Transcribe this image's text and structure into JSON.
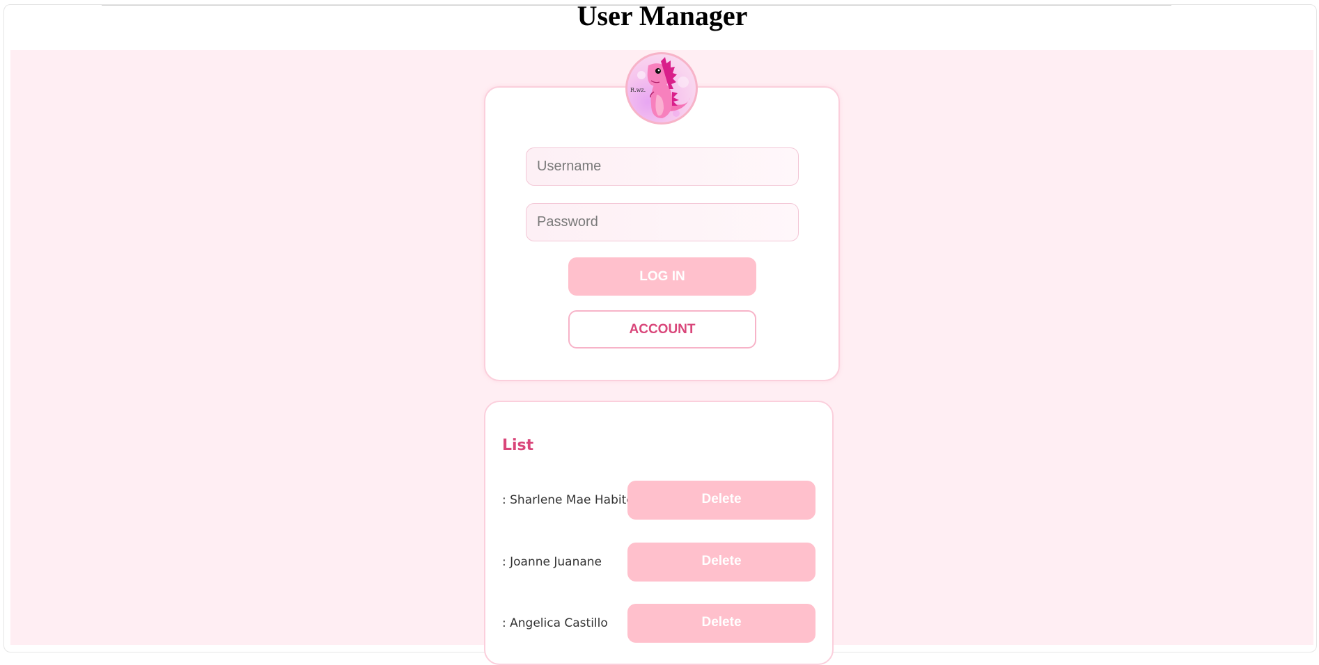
{
  "app": {
    "title": "User Manager"
  },
  "login": {
    "avatar_icon": "pink-dinosaur-avatar",
    "avatar_text": "R.wz.",
    "username_placeholder": "Username",
    "password_placeholder": "Password",
    "login_label": "LOG IN",
    "account_label": "ACCOUNT"
  },
  "list": {
    "heading": "List",
    "delete_label": "Delete",
    "items": [
      {
        "name": ": Sharlene Mae Habito"
      },
      {
        "name": ": Joanne Juanane"
      },
      {
        "name": ": Angelica Castillo"
      }
    ]
  },
  "colors": {
    "page_background": "#ffeef3",
    "accent_pink": "#ffc0cc",
    "accent_text": "#d9467a",
    "card_border": "#fbcfdc"
  }
}
